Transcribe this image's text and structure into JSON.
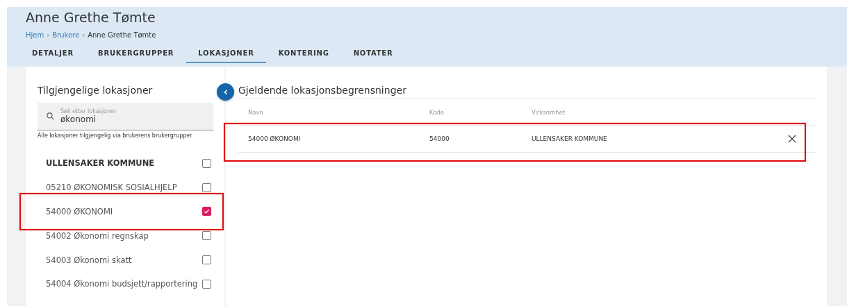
{
  "header": {
    "title": "Anne Grethe Tømte",
    "breadcrumb": [
      {
        "label": "Hjem",
        "link": true
      },
      {
        "label": "Brukere",
        "link": true
      },
      {
        "label": "Anne Grethe Tømte",
        "link": false
      }
    ],
    "separator": "›"
  },
  "tabs": [
    {
      "label": "DETALJER",
      "selected": false
    },
    {
      "label": "BRUKERGRUPPER",
      "selected": false
    },
    {
      "label": "LOKASJONER",
      "selected": true
    },
    {
      "label": "KONTERING",
      "selected": false
    },
    {
      "label": "NOTATER",
      "selected": false
    }
  ],
  "available": {
    "title": "Tilgjengelige lokasjoner",
    "search": {
      "placeholder": "Søk etter lokasjoner",
      "value": "økonomi"
    },
    "hint": "Alle lokasjoner tilgjengelig via brukerens brukergrupper",
    "items": [
      {
        "label": "ULLENSAKER KOMMUNE",
        "kind": "group",
        "checked": false
      },
      {
        "label": "05210 ØKONOMISK SOSIALHJELP",
        "kind": "item",
        "checked": false
      },
      {
        "label": "54000 ØKONOMI",
        "kind": "item",
        "checked": true
      },
      {
        "label": "54002 Økonomi regnskap",
        "kind": "item",
        "checked": false
      },
      {
        "label": "54003 Økonomi skatt",
        "kind": "item",
        "checked": false
      },
      {
        "label": "54004 Økonomi budsjett/rapportering",
        "kind": "item",
        "checked": false
      }
    ]
  },
  "current": {
    "title": "Gjeldende lokasjonsbegrensninger",
    "table": {
      "columns": [
        "Navn",
        "Kode",
        "Virksomhet"
      ],
      "rows": [
        [
          "54000 ØKONOMI",
          "54000",
          "ULLENSAKER KOMMUNE"
        ]
      ]
    }
  }
}
